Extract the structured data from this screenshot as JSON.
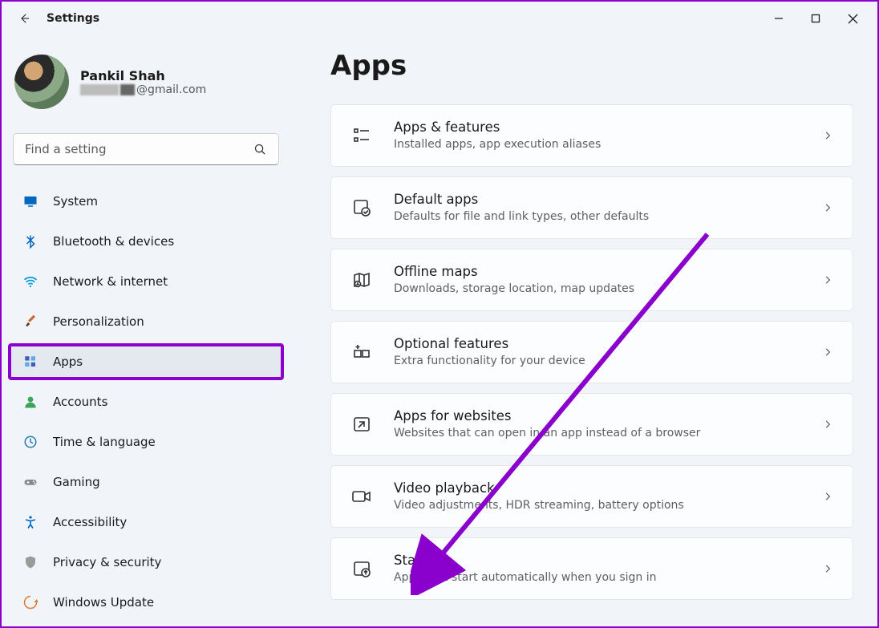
{
  "window": {
    "title": "Settings"
  },
  "profile": {
    "name": "Pankil Shah",
    "email_suffix": "@gmail.com"
  },
  "search": {
    "placeholder": "Find a setting"
  },
  "sidebar": {
    "items": [
      {
        "label": "System",
        "icon": "monitor-icon",
        "color": "#0067c0"
      },
      {
        "label": "Bluetooth & devices",
        "icon": "bluetooth-icon",
        "color": "#0067c0"
      },
      {
        "label": "Network & internet",
        "icon": "wifi-icon",
        "color": "#0099d8"
      },
      {
        "label": "Personalization",
        "icon": "brush-icon",
        "color": "#c96b35"
      },
      {
        "label": "Apps",
        "icon": "apps-icon",
        "color": "#3a5fb6",
        "active": true,
        "highlighted": true
      },
      {
        "label": "Accounts",
        "icon": "person-icon",
        "color": "#3ba55c"
      },
      {
        "label": "Time & language",
        "icon": "clock-globe-icon",
        "color": "#2a7ab0"
      },
      {
        "label": "Gaming",
        "icon": "gamepad-icon",
        "color": "#777"
      },
      {
        "label": "Accessibility",
        "icon": "accessibility-icon",
        "color": "#0067c0"
      },
      {
        "label": "Privacy & security",
        "icon": "shield-icon",
        "color": "#888"
      },
      {
        "label": "Windows Update",
        "icon": "update-icon",
        "color": "#e07b2f"
      }
    ]
  },
  "page": {
    "title": "Apps"
  },
  "cards": [
    {
      "title": "Apps & features",
      "sub": "Installed apps, app execution aliases",
      "icon": "list-icon"
    },
    {
      "title": "Default apps",
      "sub": "Defaults for file and link types, other defaults",
      "icon": "default-apps-icon"
    },
    {
      "title": "Offline maps",
      "sub": "Downloads, storage location, map updates",
      "icon": "map-icon"
    },
    {
      "title": "Optional features",
      "sub": "Extra functionality for your device",
      "icon": "optional-icon"
    },
    {
      "title": "Apps for websites",
      "sub": "Websites that can open in an app instead of a browser",
      "icon": "websites-icon"
    },
    {
      "title": "Video playback",
      "sub": "Video adjustments, HDR streaming, battery options",
      "icon": "video-icon"
    },
    {
      "title": "Startup",
      "sub": "Apps that start automatically when you sign in",
      "icon": "startup-icon"
    }
  ]
}
